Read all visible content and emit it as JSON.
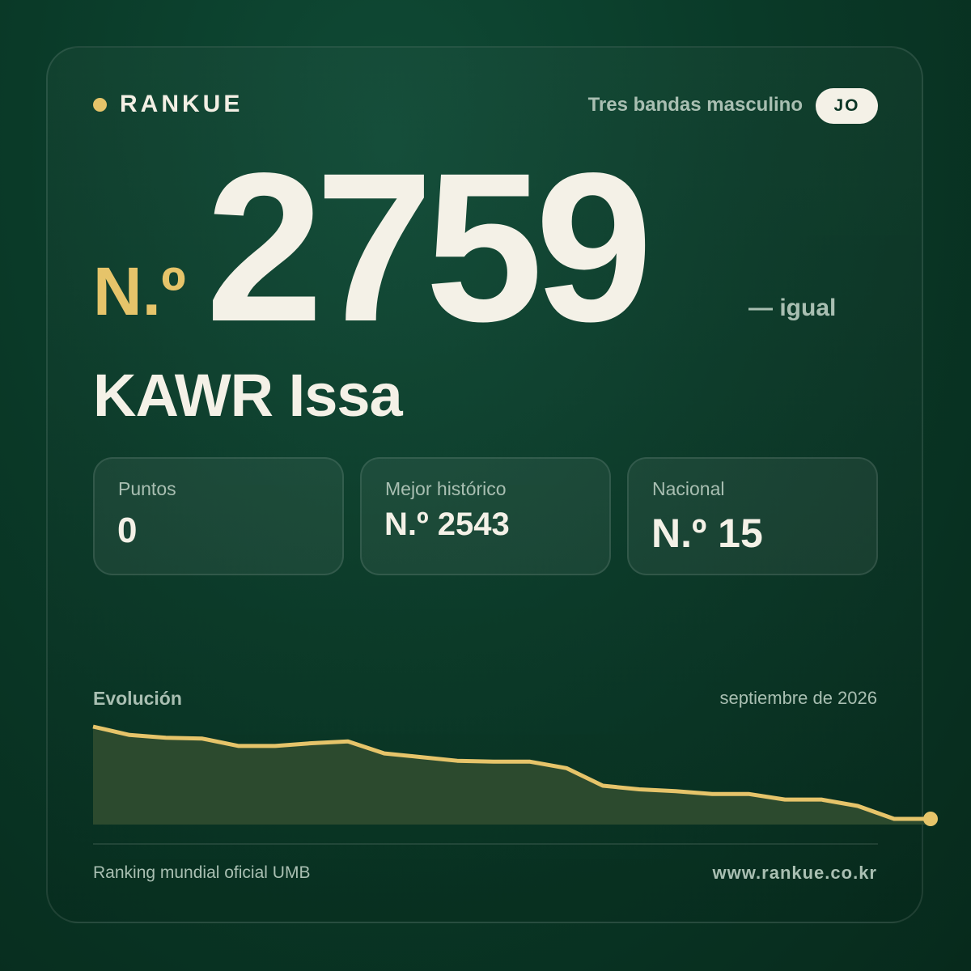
{
  "brand": {
    "name": "RANKUE",
    "dot_color": "#e6c46a"
  },
  "header": {
    "category": "Tres bandas masculino",
    "country_code": "JO"
  },
  "rank": {
    "prefix": "N.º",
    "number": "2759",
    "change": "— igual"
  },
  "player": {
    "name": "KAWR Issa"
  },
  "stats": [
    {
      "label": "Puntos",
      "value": "0"
    },
    {
      "label": "Mejor histórico",
      "value": "N.º 2543"
    },
    {
      "label": "Nacional",
      "value": "N.º 15"
    }
  ],
  "chart_data": {
    "type": "area",
    "title": "Evolución",
    "period": "septiembre de 2026",
    "values": [
      0.0,
      0.09,
      0.12,
      0.13,
      0.21,
      0.21,
      0.18,
      0.16,
      0.29,
      0.33,
      0.37,
      0.38,
      0.38,
      0.45,
      0.64,
      0.68,
      0.7,
      0.73,
      0.73,
      0.79,
      0.79,
      0.86,
      1.0,
      1.0
    ],
    "line_color": "#e6c46a",
    "fill_color": "#2c4a2e"
  },
  "footer": {
    "source": "Ranking mundial oficial UMB",
    "website": "www.rankue.co.kr"
  },
  "colors": {
    "accent": "#e6c46a",
    "text": "#f4f1e7",
    "muted": "#a9bfb2"
  }
}
